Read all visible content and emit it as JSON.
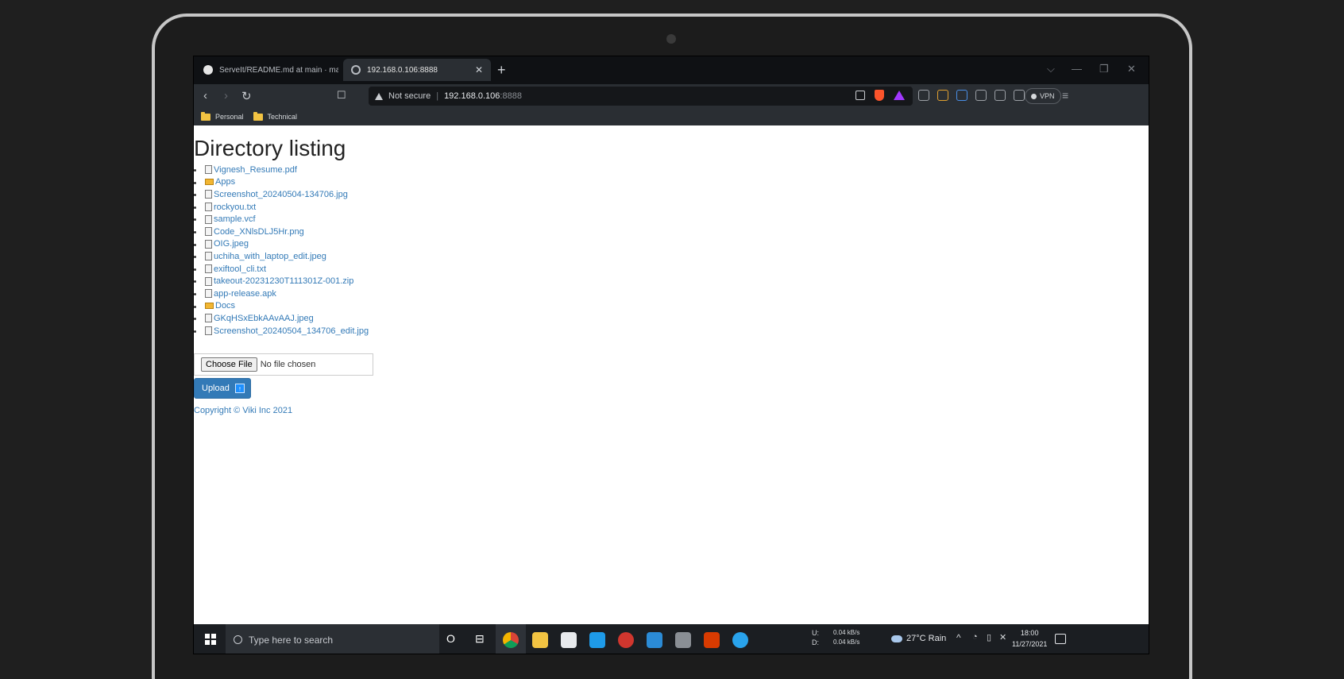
{
  "browser": {
    "tabs": [
      {
        "title": "ServeIt/README.md at main · many",
        "active": false
      },
      {
        "title": "192.168.0.106:8888",
        "active": true
      }
    ],
    "new_tab": "+",
    "window_controls": [
      "⌵",
      "—",
      "❐",
      "✕"
    ],
    "address": {
      "security": "Not secure",
      "separator": "|",
      "host": "192.168.0.106",
      "port": ":8888"
    },
    "vpn_label": "VPN",
    "bookmarks": [
      "Personal",
      "Technical"
    ]
  },
  "page": {
    "title": "Directory listing",
    "entries": [
      {
        "name": "Vignesh_Resume.pdf",
        "type": "file"
      },
      {
        "name": "Apps",
        "type": "folder"
      },
      {
        "name": "Screenshot_20240504-134706.jpg",
        "type": "file"
      },
      {
        "name": "rockyou.txt",
        "type": "file"
      },
      {
        "name": "sample.vcf",
        "type": "file"
      },
      {
        "name": "Code_XNlsDLJ5Hr.png",
        "type": "file"
      },
      {
        "name": "OIG.jpeg",
        "type": "file"
      },
      {
        "name": "uchiha_with_laptop_edit.jpeg",
        "type": "file"
      },
      {
        "name": "exiftool_cli.txt",
        "type": "file"
      },
      {
        "name": "takeout-20231230T111301Z-001.zip",
        "type": "file"
      },
      {
        "name": "app-release.apk",
        "type": "file"
      },
      {
        "name": "Docs",
        "type": "folder"
      },
      {
        "name": "GKqHSxEbkAAvAAJ.jpeg",
        "type": "file"
      },
      {
        "name": "Screenshot_20240504_134706_edit.jpg",
        "type": "file"
      }
    ],
    "choose_file_label": "Choose File",
    "no_file_text": "No file chosen",
    "upload_label": "Upload",
    "upload_icon": "↑",
    "copyright": "Copyright © Viki Inc 2021"
  },
  "taskbar": {
    "search_placeholder": "Type here to search",
    "cortana_icon": "O",
    "taskview_icon": "⊟",
    "net_up_label": "U:",
    "net_down_label": "D:",
    "net_up": "0.04 kB/s",
    "net_down": "0.04 kB/s",
    "weather": "27°C  Rain",
    "time": "18:00",
    "date": "11/27/2021"
  },
  "colors": {
    "link": "#337ab7",
    "upload_button": "#337ab7",
    "taskbar": "#1b1e22"
  }
}
